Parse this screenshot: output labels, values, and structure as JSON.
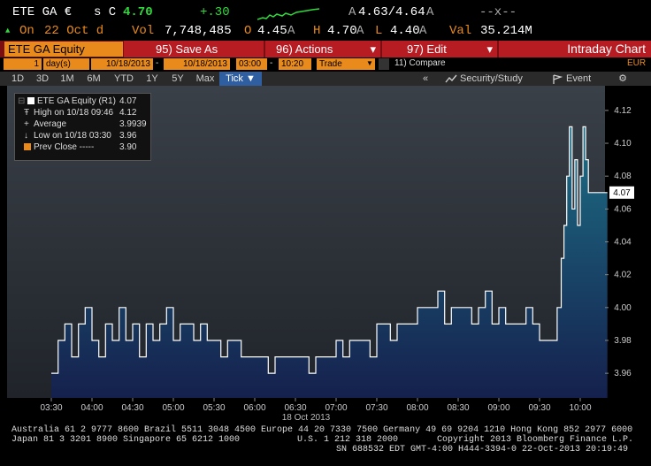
{
  "quote": {
    "security": "ETE GA €",
    "side": "s C",
    "last": "4.70",
    "change": "+.30",
    "bid_label": "A",
    "bid_ask": "4.63/4.64",
    "ask_suffix": "A",
    "dash_x": "--x--",
    "on_label": "On",
    "date": "22 Oct d",
    "vol_label": "Vol",
    "volume": "7,748,485",
    "open_label": "O",
    "open": "4.45",
    "open_suffix": "A",
    "high_label": "H",
    "high": "4.70",
    "high_suffix": "A",
    "low_label": "L",
    "low": "4.40",
    "low_suffix": "A",
    "val_label": "Val",
    "value": "35.214M",
    "up_arrow": "▲",
    "down_arrow": "▼"
  },
  "function_bar": {
    "ticker": "ETE GA Equity",
    "save_as": "95) Save As",
    "actions": "96) Actions",
    "edit": "97) Edit",
    "title": "Intraday Chart",
    "dropdown_arrow": "▾"
  },
  "settings": {
    "period_num": "1",
    "period_unit": "day(s)",
    "start_date": "10/18/2013",
    "end_date": "10/18/2013",
    "start_time": "03:00",
    "end_time": "10:20",
    "dash": "-",
    "event": "Trade",
    "compare": "11) Compare",
    "currency": "EUR"
  },
  "toolbar": {
    "ranges": [
      "1D",
      "3D",
      "1M",
      "6M",
      "YTD",
      "1Y",
      "5Y",
      "Max"
    ],
    "tick": "Tick ▼",
    "collapse": "«",
    "security_study": "Security/Study",
    "event": "Event",
    "settings_icon": "⚙",
    "arrow": "▼"
  },
  "legend": {
    "r1_name": "ETE GA Equity (R1)",
    "r1_value": "4.07",
    "high_label": "High on 10/18 09:46",
    "high_value": "4.12",
    "avg_label": "Average",
    "avg_value": "3.9939",
    "low_label": "Low on 10/18 03:30",
    "low_value": "3.96",
    "prev_label": "Prev Close -----",
    "prev_value": "3.90"
  },
  "chart_data": {
    "type": "area",
    "xlabel": "18 Oct 2013",
    "x_ticks": [
      "03:30",
      "04:00",
      "04:30",
      "05:00",
      "05:30",
      "06:00",
      "06:30",
      "07:00",
      "07:30",
      "08:00",
      "08:30",
      "09:00",
      "09:30",
      "10:00"
    ],
    "y_ticks": [
      "3.96",
      "3.98",
      "4.00",
      "4.02",
      "4.04",
      "4.06",
      "4.08",
      "4.10",
      "4.12"
    ],
    "ylim": [
      3.945,
      4.135
    ],
    "last_value_label": "4.07",
    "x": [
      "03:30",
      "03:35",
      "03:40",
      "03:45",
      "03:50",
      "03:55",
      "04:00",
      "04:05",
      "04:10",
      "04:15",
      "04:20",
      "04:25",
      "04:30",
      "04:35",
      "04:40",
      "04:45",
      "04:50",
      "04:55",
      "05:00",
      "05:05",
      "05:10",
      "05:15",
      "05:20",
      "05:25",
      "05:30",
      "05:35",
      "05:40",
      "05:45",
      "05:50",
      "05:55",
      "06:00",
      "06:05",
      "06:10",
      "06:15",
      "06:20",
      "06:25",
      "06:30",
      "06:35",
      "06:40",
      "06:45",
      "06:50",
      "06:55",
      "07:00",
      "07:05",
      "07:10",
      "07:15",
      "07:20",
      "07:25",
      "07:30",
      "07:35",
      "07:40",
      "07:45",
      "07:50",
      "07:55",
      "08:00",
      "08:05",
      "08:10",
      "08:15",
      "08:20",
      "08:25",
      "08:30",
      "08:35",
      "08:40",
      "08:45",
      "08:50",
      "08:55",
      "09:00",
      "09:05",
      "09:10",
      "09:15",
      "09:20",
      "09:25",
      "09:30",
      "09:35",
      "09:40",
      "09:43",
      "09:46",
      "09:48",
      "09:50",
      "09:52",
      "09:54",
      "09:56",
      "09:58",
      "10:00",
      "10:02",
      "10:04",
      "10:06",
      "10:08",
      "10:10",
      "10:14",
      "10:20"
    ],
    "values": [
      3.96,
      3.98,
      3.99,
      3.97,
      3.99,
      4.0,
      3.98,
      3.97,
      3.99,
      3.98,
      4.0,
      3.98,
      3.99,
      3.97,
      3.99,
      3.98,
      3.99,
      4.0,
      3.98,
      3.99,
      3.99,
      3.98,
      3.99,
      3.98,
      3.98,
      3.97,
      3.98,
      3.98,
      3.97,
      3.97,
      3.97,
      3.97,
      3.96,
      3.97,
      3.97,
      3.97,
      3.97,
      3.97,
      3.96,
      3.97,
      3.97,
      3.97,
      3.98,
      3.97,
      3.98,
      3.98,
      3.98,
      3.97,
      3.99,
      3.99,
      3.98,
      3.99,
      3.99,
      3.99,
      4.0,
      4.0,
      4.0,
      4.01,
      3.99,
      4.0,
      4.0,
      4.0,
      3.99,
      4.0,
      4.01,
      3.99,
      4.0,
      3.99,
      3.99,
      3.99,
      4.0,
      3.99,
      3.98,
      3.98,
      3.98,
      4.0,
      4.03,
      4.05,
      4.08,
      4.11,
      4.06,
      4.09,
      4.05,
      4.08,
      4.11,
      4.09,
      4.07,
      4.07,
      4.07,
      4.07,
      4.07
    ],
    "colors": {
      "line": "#ffffff",
      "fill_top": "#1d6f86",
      "fill_bottom": "#15204d",
      "bg_top": "#3a4048",
      "bg_bottom": "#20242a"
    }
  },
  "footer": {
    "line1": "Australia 61 2 9777 8600 Brazil 5511 3048 4500 Europe 44 20 7330 7500 Germany 49 69 9204 1210 Hong Kong 852 2977 6000",
    "line2_left": "Japan 81 3 3201 8900        Singapore 65 6212 1000",
    "line2_mid": "U.S. 1 212 318 2000",
    "line2_right": "Copyright 2013 Bloomberg Finance L.P.",
    "line3": "SN 688532 EDT  GMT-4:00 H444-3394-0 22-Oct-2013 20:19:49"
  }
}
